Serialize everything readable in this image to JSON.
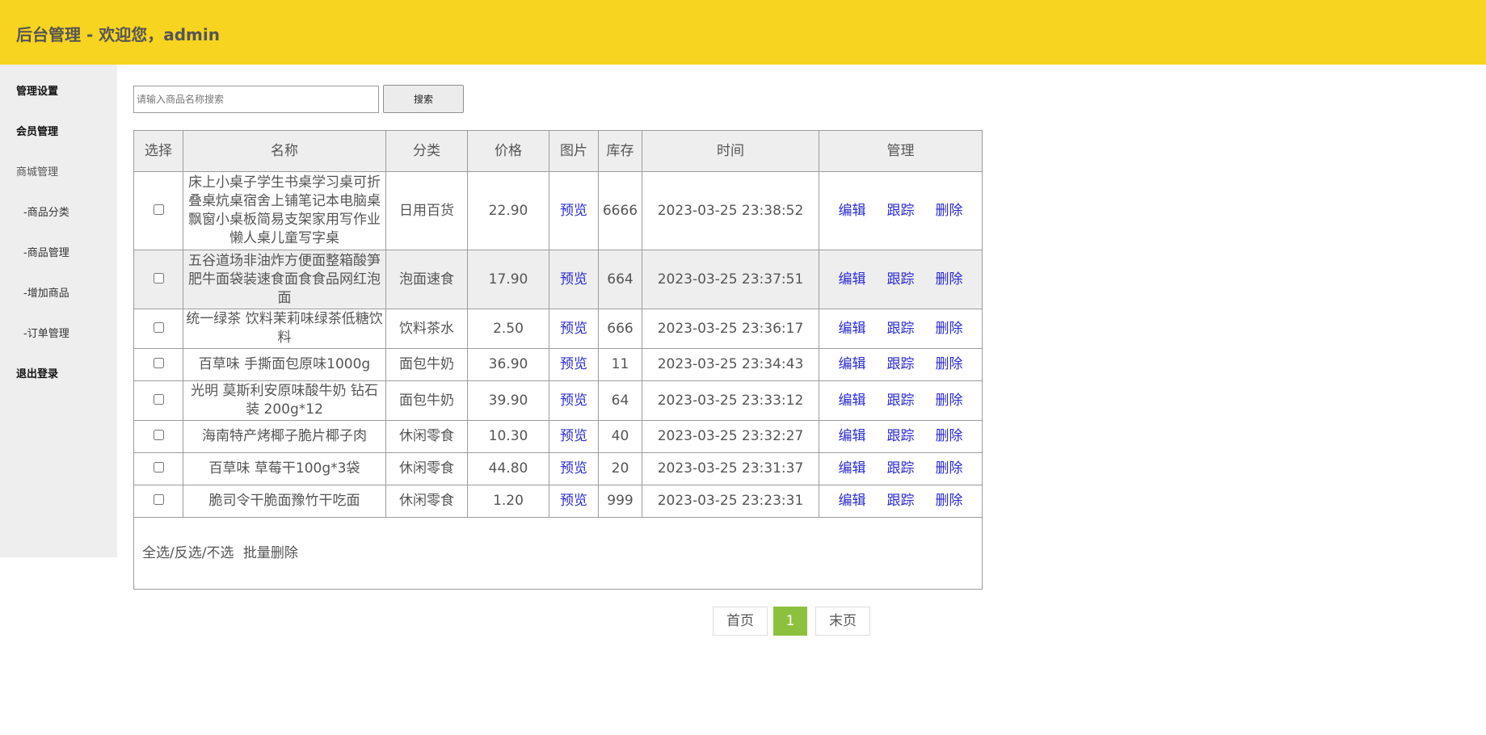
{
  "header": {
    "title": "后台管理 - 欢迎您，admin"
  },
  "sidebar": {
    "items": [
      {
        "label": "管理设置"
      },
      {
        "label": "会员管理"
      },
      {
        "label": "商城管理"
      },
      {
        "label": "-商品分类"
      },
      {
        "label": "-商品管理"
      },
      {
        "label": "-增加商品"
      },
      {
        "label": "-订单管理"
      },
      {
        "label": "退出登录"
      }
    ]
  },
  "search": {
    "placeholder": "请输入商品名称搜索",
    "button_label": "搜索"
  },
  "table": {
    "headers": [
      "选择",
      "名称",
      "分类",
      "价格",
      "图片",
      "库存",
      "时间",
      "管理"
    ],
    "preview_label": "预览",
    "actions": [
      "编辑",
      "跟踪",
      "删除"
    ],
    "rows": [
      {
        "name": "床上小桌子学生书桌学习桌可折叠桌炕桌宿舍上铺笔记本电脑桌飘窗小桌板简易支架家用写作业懒人桌儿童写字桌",
        "category": "日用百货",
        "price": "22.90",
        "stock": "6666",
        "time": "2023-03-25 23:38:52"
      },
      {
        "name": "五谷道场非油炸方便面整箱酸笋肥牛面袋装速食面食食品网红泡面",
        "category": "泡面速食",
        "price": "17.90",
        "stock": "664",
        "time": "2023-03-25 23:37:51"
      },
      {
        "name": "统一绿茶 饮料茉莉味绿茶低糖饮料",
        "category": "饮料茶水",
        "price": "2.50",
        "stock": "666",
        "time": "2023-03-25 23:36:17"
      },
      {
        "name": "百草味 手撕面包原味1000g",
        "category": "面包牛奶",
        "price": "36.90",
        "stock": "11",
        "time": "2023-03-25 23:34:43"
      },
      {
        "name": "光明 莫斯利安原味酸牛奶 钻石装 200g*12",
        "category": "面包牛奶",
        "price": "39.90",
        "stock": "64",
        "time": "2023-03-25 23:33:12"
      },
      {
        "name": "海南特产烤椰子脆片椰子肉",
        "category": "休闲零食",
        "price": "10.30",
        "stock": "40",
        "time": "2023-03-25 23:32:27"
      },
      {
        "name": "百草味 草莓干100g*3袋",
        "category": "休闲零食",
        "price": "44.80",
        "stock": "20",
        "time": "2023-03-25 23:31:37"
      },
      {
        "name": "脆司令干脆面豫竹干吃面",
        "category": "休闲零食",
        "price": "1.20",
        "stock": "999",
        "time": "2023-03-25 23:23:31"
      }
    ],
    "footer": {
      "select_label": "全选/反选/不选",
      "batch_delete_label": "批量删除"
    }
  },
  "pagination": {
    "first_label": "首页",
    "current_page": "1",
    "last_label": "末页"
  },
  "colors": {
    "header_bg": "#f7d420",
    "sidebar_bg": "#eeeeee",
    "link": "#2b2bd4",
    "current_page_bg": "#8cc13d"
  }
}
